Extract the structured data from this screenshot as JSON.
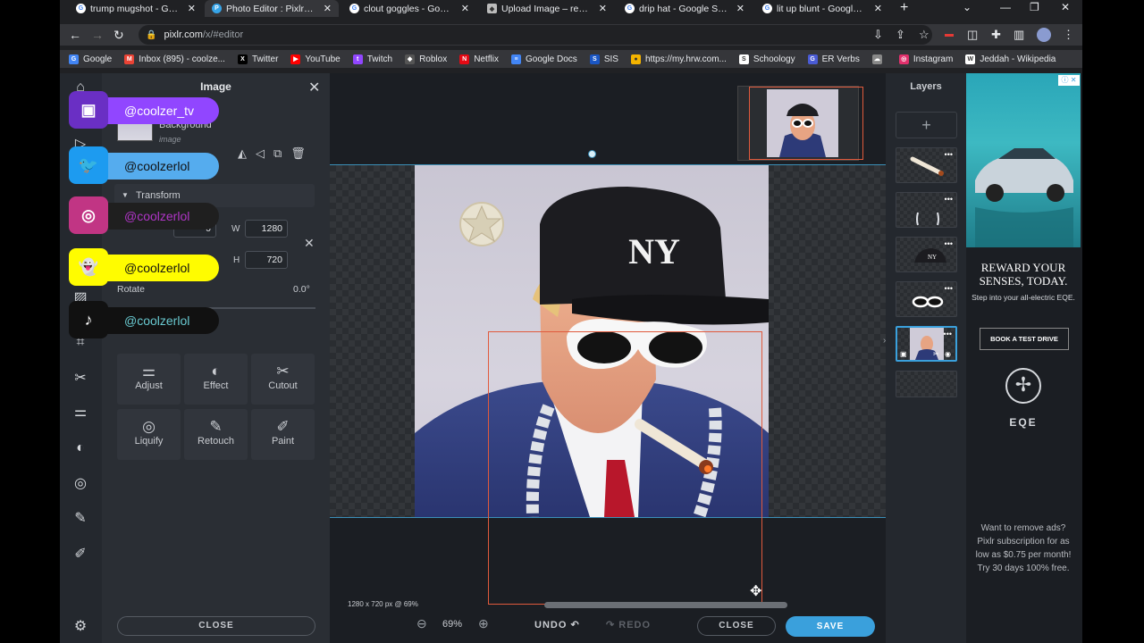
{
  "tabs": [
    {
      "title": "trump mugshot - Googl",
      "icon": "google-icon",
      "active": false
    },
    {
      "title": "Photo Editor : Pixlr X - fr",
      "icon": "pixlr-icon",
      "active": true
    },
    {
      "title": "clout goggles - Google S",
      "icon": "google-icon",
      "active": false
    },
    {
      "title": "Upload Image – remove",
      "icon": "removebg-icon",
      "active": false
    },
    {
      "title": "drip hat - Google Search",
      "icon": "google-icon",
      "active": false
    },
    {
      "title": "lit up blunt - Google Sea",
      "icon": "google-icon",
      "active": false
    }
  ],
  "address": {
    "host": "pixlr.com",
    "path": "/x/#editor"
  },
  "bookmarks": [
    {
      "label": "Google",
      "color": "#4285f4",
      "glyph": "G"
    },
    {
      "label": "Inbox (895) - coolze...",
      "color": "#ea4335",
      "glyph": "M"
    },
    {
      "label": "Twitter",
      "color": "#000000",
      "glyph": "X"
    },
    {
      "label": "YouTube",
      "color": "#ff0000",
      "glyph": "▶"
    },
    {
      "label": "Twitch",
      "color": "#9146ff",
      "glyph": "t"
    },
    {
      "label": "Roblox",
      "color": "#555555",
      "glyph": "◆"
    },
    {
      "label": "Netflix",
      "color": "#e50914",
      "glyph": "N"
    },
    {
      "label": "Google Docs",
      "color": "#4285f4",
      "glyph": "≡"
    },
    {
      "label": "SIS",
      "color": "#1a56c4",
      "glyph": "S"
    },
    {
      "label": "https://my.hrw.com...",
      "color": "#f4b400",
      "glyph": "●"
    },
    {
      "label": "Schoology",
      "color": "#ffffff",
      "glyph": "S"
    },
    {
      "label": "ER Verbs",
      "color": "#4a5bd4",
      "glyph": "G"
    },
    {
      "label": "",
      "color": "#888888",
      "glyph": "☁"
    },
    {
      "label": "Instagram",
      "color": "#e1306c",
      "glyph": "◎"
    },
    {
      "label": "Jeddah - Wikipedia",
      "color": "#ffffff",
      "glyph": "W"
    }
  ],
  "panel": {
    "title": "Image",
    "layer_name": "Background",
    "layer_type": "image",
    "transform_label": "Transform",
    "w_label": "W",
    "h_label": "H",
    "x_value": "0",
    "w_value": "1280",
    "h_value": "720",
    "rotate_label": "Rotate",
    "rotate_value": "0.0°",
    "tools": [
      {
        "label": "Adjust",
        "icon": "sliders-icon",
        "glyph": "⚌"
      },
      {
        "label": "Effect",
        "icon": "effect-icon",
        "glyph": "◐"
      },
      {
        "label": "Cutout",
        "icon": "scissors-icon",
        "glyph": "✂"
      },
      {
        "label": "Liquify",
        "icon": "swirl-icon",
        "glyph": "◎"
      },
      {
        "label": "Retouch",
        "icon": "bandage-icon",
        "glyph": "✎"
      },
      {
        "label": "Paint",
        "icon": "brush-icon",
        "glyph": "✐"
      }
    ],
    "close_label": "CLOSE"
  },
  "socials": [
    {
      "handle": "@coolzer_tv",
      "icon": "twitch-icon",
      "bg": "#9146ff",
      "icon_bg": "#6a2fc4",
      "text": "#ffffff",
      "glyph": "▣"
    },
    {
      "handle": "@coolzerlol",
      "icon": "twitter-icon",
      "bg": "#55acee",
      "icon_bg": "#1d9bf0",
      "text": "#111111",
      "glyph": "🐦"
    },
    {
      "handle": "@coolzerlol",
      "icon": "instagram-icon",
      "bg": "#1f1f1f",
      "icon_bg": "#c13584",
      "text": "#b035c7",
      "glyph": "◎"
    },
    {
      "handle": "@coolzerlol",
      "icon": "snapchat-icon",
      "bg": "#fffc00",
      "icon_bg": "#fffc00",
      "text": "#111111",
      "glyph": "👻"
    },
    {
      "handle": "@coolzerlol",
      "icon": "tiktok-icon",
      "bg": "#111111",
      "icon_bg": "#111111",
      "text": "#69c9d0",
      "glyph": "♪"
    }
  ],
  "canvas": {
    "status": "1280 x 720 px @ 69%",
    "zoom": "69%",
    "undo": "UNDO",
    "redo": "REDO",
    "close": "CLOSE",
    "save": "SAVE"
  },
  "layers": {
    "title": "Layers",
    "items": [
      {
        "name": "blunt-layer"
      },
      {
        "name": "chain-layer"
      },
      {
        "name": "hat-layer"
      },
      {
        "name": "goggles-layer"
      },
      {
        "name": "background-layer",
        "selected": true
      },
      {
        "name": "empty-layer"
      }
    ]
  },
  "ad": {
    "headline": "REWARD YOUR SENSES, TODAY.",
    "sub": "Step into your all-electric EQE.",
    "cta": "BOOK A TEST DRIVE",
    "brand": "EQE",
    "promo": "Want to remove ads? Pixlr subscription for as low as $0.75 per month! Try 30 days 100% free."
  },
  "colors": {
    "accent": "#3aa0dc",
    "selection": "#e05a3c"
  }
}
